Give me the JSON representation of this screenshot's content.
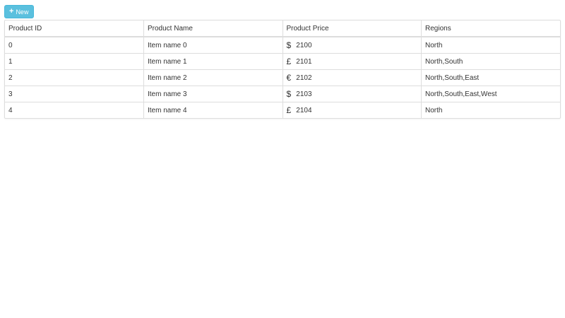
{
  "toolbar": {
    "new_label": "New",
    "new_icon": "plus-icon"
  },
  "table": {
    "headers": [
      "Product ID",
      "Product Name",
      "Product Price",
      "Regions"
    ],
    "rows": [
      {
        "id": "0",
        "name": "Item name 0",
        "currency": "$",
        "price": "2100",
        "regions": "North"
      },
      {
        "id": "1",
        "name": "Item name 1",
        "currency": "£",
        "price": "2101",
        "regions": "North,South"
      },
      {
        "id": "2",
        "name": "Item name 2",
        "currency": "€",
        "price": "2102",
        "regions": "North,South,East"
      },
      {
        "id": "3",
        "name": "Item name 3",
        "currency": "$",
        "price": "2103",
        "regions": "North,South,East,West"
      },
      {
        "id": "4",
        "name": "Item name 4",
        "currency": "£",
        "price": "2104",
        "regions": "North"
      }
    ]
  },
  "colors": {
    "button_bg": "#5bc0de",
    "border": "#dddddd",
    "text": "#333333"
  }
}
